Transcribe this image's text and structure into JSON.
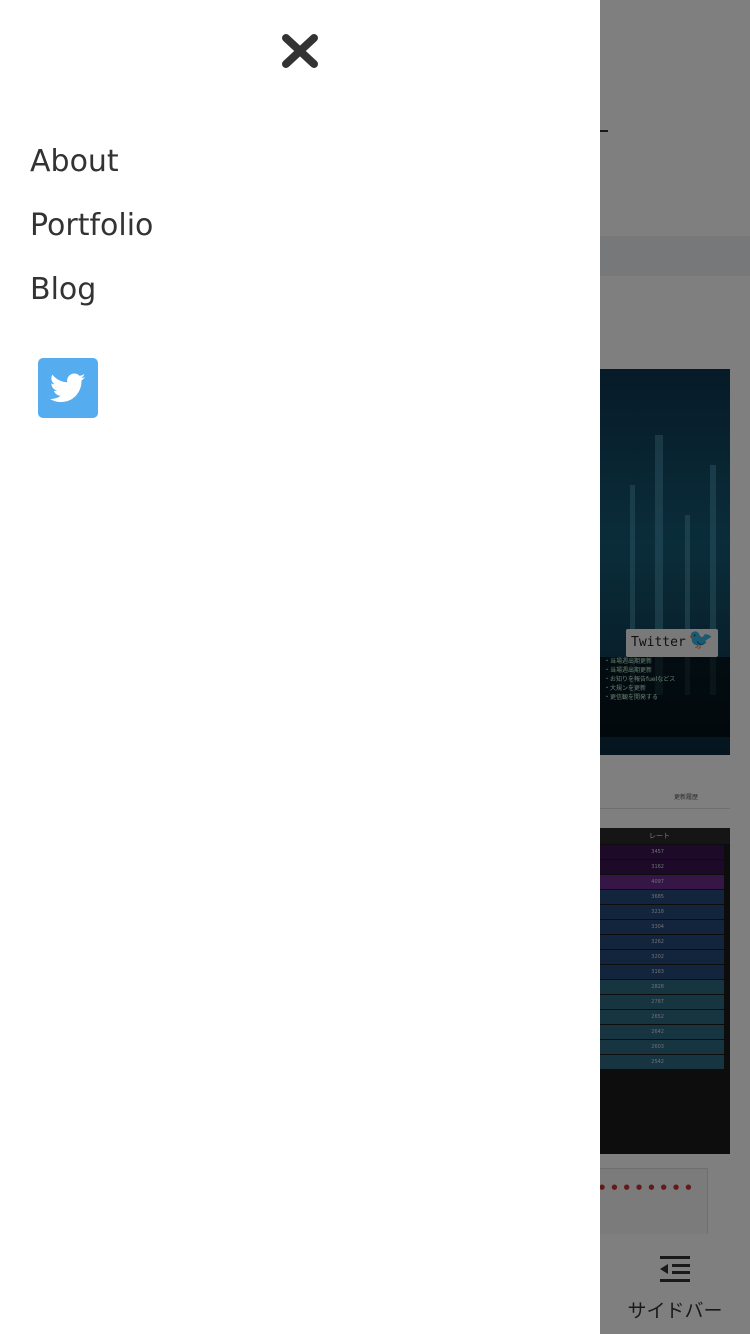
{
  "drawer": {
    "close_icon": "close-icon",
    "nav_items": [
      {
        "label": "About"
      },
      {
        "label": "Portfolio"
      },
      {
        "label": "Blog"
      }
    ],
    "social": {
      "icon": "twitter-icon",
      "color": "#55acee"
    }
  },
  "background": {
    "hero_badge": "Twitter",
    "hero_list": [
      "・当場週出期更新",
      "・当場週出期更新",
      "・お知りを報告fuelなどス",
      "・大規ンを更新",
      "・更信観を開発する"
    ],
    "tabs": [
      "",
      "更新履歴"
    ],
    "table_header": "レート",
    "table_rows": [
      {
        "value": "3457",
        "color": "#3b1552"
      },
      {
        "value": "3162",
        "color": "#3b1552"
      },
      {
        "value": "4097",
        "color": "#6b2c8f"
      },
      {
        "value": "3685",
        "color": "#264b78"
      },
      {
        "value": "3218",
        "color": "#264b78"
      },
      {
        "value": "3304",
        "color": "#264b78"
      },
      {
        "value": "3262",
        "color": "#264b78"
      },
      {
        "value": "3202",
        "color": "#264b78"
      },
      {
        "value": "3163",
        "color": "#264b78"
      },
      {
        "value": "2828",
        "color": "#2c6a80"
      },
      {
        "value": "2787",
        "color": "#2c6a80"
      },
      {
        "value": "2652",
        "color": "#2c6a80"
      },
      {
        "value": "2642",
        "color": "#2c6a80"
      },
      {
        "value": "2603",
        "color": "#2c6a80"
      },
      {
        "value": "2542",
        "color": "#2c6a80"
      }
    ],
    "sidebar_button": {
      "label": "サイドバー",
      "icon": "sidebar-toggle-icon"
    }
  }
}
